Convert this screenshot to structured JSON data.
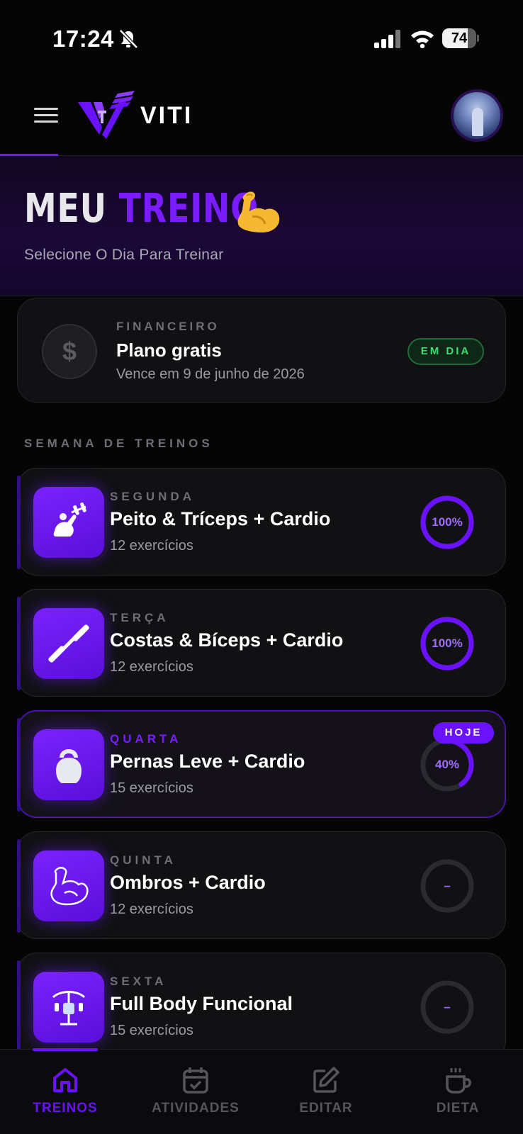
{
  "status_bar": {
    "time": "17:24",
    "battery": "74",
    "battery_level": 0.74
  },
  "header": {
    "logo_text": "VITI"
  },
  "hero": {
    "title_part1": "MEU",
    "title_part2": "TREINO",
    "emoji": "💪",
    "subtitle": "Selecione O Dia Para Treinar"
  },
  "finance": {
    "label": "FINANCEIRO",
    "title": "Plano gratis",
    "subtitle": "Vence em 9 de junho de 2026",
    "status": "EM DIA",
    "icon": "dollar-icon"
  },
  "week": {
    "label": "SEMANA DE TREINOS",
    "days": [
      {
        "day": "SEGUNDA",
        "name": "Peito & Tríceps + Cardio",
        "count": "12 exercícios",
        "progress_text": "100%",
        "progress": 1.0,
        "icon": "bench-press-icon",
        "today": false
      },
      {
        "day": "TERÇA",
        "name": "Costas & Bíceps + Cardio",
        "count": "12 exercícios",
        "progress_text": "100%",
        "progress": 1.0,
        "icon": "dumbbell-icon",
        "today": false
      },
      {
        "day": "QUARTA",
        "name": "Pernas Leve + Cardio",
        "count": "15 exercícios",
        "progress_text": "40%",
        "progress": 0.4,
        "icon": "kettlebell-icon",
        "today": true,
        "today_label": "HOJE"
      },
      {
        "day": "QUINTA",
        "name": "Ombros + Cardio",
        "count": "12 exercícios",
        "progress_text": "–",
        "progress": 0,
        "icon": "flexed-arm-icon",
        "today": false
      },
      {
        "day": "SEXTA",
        "name": "Full Body Funcional",
        "count": "15 exercícios",
        "progress_text": "–",
        "progress": 0,
        "icon": "gym-machine-icon",
        "today": false
      }
    ]
  },
  "nav": {
    "items": [
      {
        "label": "TREINOS",
        "icon": "home-icon",
        "active": true
      },
      {
        "label": "ATIVIDADES",
        "icon": "calendar-check-icon",
        "active": false
      },
      {
        "label": "EDITAR",
        "icon": "edit-icon",
        "active": false
      },
      {
        "label": "DIETA",
        "icon": "coffee-cup-icon",
        "active": false
      }
    ]
  },
  "colors": {
    "accent": "#6a12ff",
    "success": "#3ddc73",
    "background": "#050506",
    "card": "#111114"
  }
}
